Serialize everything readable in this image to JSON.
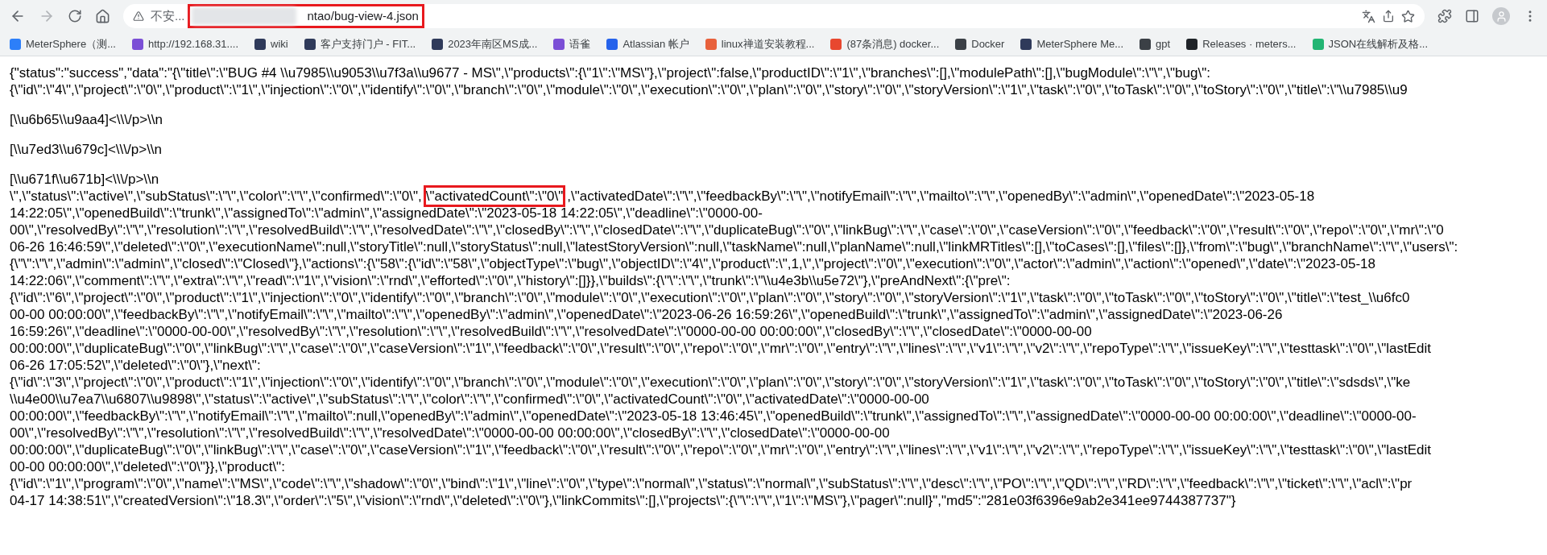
{
  "browser": {
    "address": {
      "security": "不安...",
      "url": "ntao/bug-view-4.json",
      "url_highlighted": true
    }
  },
  "bookmarks": [
    {
      "label": "MeterSphere（测...",
      "color": "#2d7ff9"
    },
    {
      "label": "http://192.168.31....",
      "color": "#7b4fd6"
    },
    {
      "label": "wiki",
      "color": "#2f3a5a"
    },
    {
      "label": "客户支持门户 - FIT...",
      "color": "#2f3a5a"
    },
    {
      "label": "2023年南区MS成...",
      "color": "#2f3a5a"
    },
    {
      "label": "语雀",
      "color": "#7b4fd6"
    },
    {
      "label": "Atlassian 帐户",
      "color": "#2663eb"
    },
    {
      "label": "linux禅道安装教程...",
      "color": "#e8613c"
    },
    {
      "label": "(87条消息) docker...",
      "color": "#e8472f"
    },
    {
      "label": "Docker",
      "color": "#3b4046"
    },
    {
      "label": "MeterSphere  Me...",
      "color": "#2f3a5a"
    },
    {
      "label": "gpt",
      "color": "#3b4046"
    },
    {
      "label": "Releases · meters...",
      "color": "#1f2328"
    },
    {
      "label": "JSON在线解析及格...",
      "color": "#22b573"
    }
  ],
  "paragraphs": [
    {
      "lines": [
        {
          "segments": [
            {
              "text": "{\"status\":\"success\",\"data\":\"{\\\"title\\\":\\\"BUG #4 \\\\u7985\\\\u9053\\\\u7f3a\\\\u9677 - MS\\\",\\\"products\\\":{\\\"1\\\":\\\"MS\\\"},\\\"project\\\":false,\\\"productID\\\":\\\"1\\\",\\\"branches\\\":[],\\\"modulePath\\\":[],\\\"bugModule\\\":\\\"\\\",\\\"bug\\\":",
              "highlighted": false
            }
          ]
        },
        {
          "segments": [
            {
              "text": "{\\\"id\\\":\\\"4\\\",\\\"project\\\":\\\"0\\\",\\\"product\\\":\\\"1\\\",\\\"injection\\\":\\\"0\\\",\\\"identify\\\":\\\"0\\\",\\\"branch\\\":\\\"0\\\",\\\"module\\\":\\\"0\\\",\\\"execution\\\":\\\"0\\\",\\\"plan\\\":\\\"0\\\",\\\"story\\\":\\\"0\\\",\\\"storyVersion\\\":\\\"1\\\",\\\"task\\\":\\\"0\\\",\\\"toTask\\\":\\\"0\\\",\\\"toStory\\\":\\\"0\\\",\\\"title\\\":\\\"\\\\u7985\\\\u9",
              "highlighted": false
            }
          ]
        }
      ]
    },
    {
      "lines": [
        {
          "segments": [
            {
              "text": "[\\\\u6b65\\\\u9aa4]<\\\\\\/p>\\\\n",
              "highlighted": false
            }
          ]
        }
      ]
    },
    {
      "lines": [
        {
          "segments": [
            {
              "text": "[\\\\u7ed3\\\\u679c]<\\\\\\/p>\\\\n",
              "highlighted": false
            }
          ]
        }
      ]
    },
    {
      "lines": [
        {
          "segments": [
            {
              "text": "[\\\\u671f\\\\u671b]<\\\\\\/p>\\\\n",
              "highlighted": false
            }
          ]
        },
        {
          "segments": [
            {
              "text": "\\\",\\\"status\\\":\\\"active\\\",\\\"subStatus\\\":\\\"\\\",\\\"color\\\":\\\"\\\",\\\"confirmed\\\":\\\"0\\\",",
              "highlighted": false
            },
            {
              "text": "\\\"activatedCount\\\":\\\"0\\\"",
              "highlighted": true
            },
            {
              "text": ",\\\"activatedDate\\\":\\\"\\\",\\\"feedbackBy\\\":\\\"\\\",\\\"notifyEmail\\\":\\\"\\\",\\\"mailto\\\":\\\"\\\",\\\"openedBy\\\":\\\"admin\\\",\\\"openedDate\\\":\\\"2023-05-18",
              "highlighted": false
            }
          ]
        },
        {
          "segments": [
            {
              "text": "14:22:05\\\",\\\"openedBuild\\\":\\\"trunk\\\",\\\"assignedTo\\\":\\\"admin\\\",\\\"assignedDate\\\":\\\"2023-05-18 14:22:05\\\",\\\"deadline\\\":\\\"0000-00-",
              "highlighted": false
            }
          ]
        },
        {
          "segments": [
            {
              "text": "00\\\",\\\"resolvedBy\\\":\\\"\\\",\\\"resolution\\\":\\\"\\\",\\\"resolvedBuild\\\":\\\"\\\",\\\"resolvedDate\\\":\\\"\\\",\\\"closedBy\\\":\\\"\\\",\\\"closedDate\\\":\\\"\\\",\\\"duplicateBug\\\":\\\"0\\\",\\\"linkBug\\\":\\\"\\\",\\\"case\\\":\\\"0\\\",\\\"caseVersion\\\":\\\"0\\\",\\\"feedback\\\":\\\"0\\\",\\\"result\\\":\\\"0\\\",\\\"repo\\\":\\\"0\\\",\\\"mr\\\":\\\"0",
              "highlighted": false
            }
          ]
        },
        {
          "segments": [
            {
              "text": "06-26 16:46:59\\\",\\\"deleted\\\":\\\"0\\\",\\\"executionName\\\":null,\\\"storyTitle\\\":null,\\\"storyStatus\\\":null,\\\"latestStoryVersion\\\":null,\\\"taskName\\\":null,\\\"planName\\\":null,\\\"linkMRTitles\\\":[],\\\"toCases\\\":[],\\\"files\\\":[]},\\\"from\\\":\\\"bug\\\",\\\"branchName\\\":\\\"\\\",\\\"users\\\":",
              "highlighted": false
            }
          ]
        },
        {
          "segments": [
            {
              "text": "{\\\"\\\":\\\"\\\",\\\"admin\\\":\\\"admin\\\",\\\"closed\\\":\\\"Closed\\\"},\\\"actions\\\":{\\\"58\\\":{\\\"id\\\":\\\"58\\\",\\\"objectType\\\":\\\"bug\\\",\\\"objectID\\\":\\\"4\\\",\\\"product\\\":\\\",1,\\\",\\\"project\\\":\\\"0\\\",\\\"execution\\\":\\\"0\\\",\\\"actor\\\":\\\"admin\\\",\\\"action\\\":\\\"opened\\\",\\\"date\\\":\\\"2023-05-18",
              "highlighted": false
            }
          ]
        },
        {
          "segments": [
            {
              "text": "14:22:06\\\",\\\"comment\\\":\\\"\\\",\\\"extra\\\":\\\"\\\",\\\"read\\\":\\\"1\\\",\\\"vision\\\":\\\"rnd\\\",\\\"efforted\\\":\\\"0\\\",\\\"history\\\":[]}},\\\"builds\\\":{\\\"\\\":\\\"\\\",\\\"trunk\\\":\\\"\\\\u4e3b\\\\u5e72\\\"},\\\"preAndNext\\\":{\\\"pre\\\":",
              "highlighted": false
            }
          ]
        },
        {
          "segments": [
            {
              "text": "{\\\"id\\\":\\\"6\\\",\\\"project\\\":\\\"0\\\",\\\"product\\\":\\\"1\\\",\\\"injection\\\":\\\"0\\\",\\\"identify\\\":\\\"0\\\",\\\"branch\\\":\\\"0\\\",\\\"module\\\":\\\"0\\\",\\\"execution\\\":\\\"0\\\",\\\"plan\\\":\\\"0\\\",\\\"story\\\":\\\"0\\\",\\\"storyVersion\\\":\\\"1\\\",\\\"task\\\":\\\"0\\\",\\\"toTask\\\":\\\"0\\\",\\\"toStory\\\":\\\"0\\\",\\\"title\\\":\\\"test_\\\\u6fc0",
              "highlighted": false
            }
          ]
        },
        {
          "segments": [
            {
              "text": "00-00 00:00:00\\\",\\\"feedbackBy\\\":\\\"\\\",\\\"notifyEmail\\\":\\\"\\\",\\\"mailto\\\":\\\"\\\",\\\"openedBy\\\":\\\"admin\\\",\\\"openedDate\\\":\\\"2023-06-26 16:59:26\\\",\\\"openedBuild\\\":\\\"trunk\\\",\\\"assignedTo\\\":\\\"admin\\\",\\\"assignedDate\\\":\\\"2023-06-26",
              "highlighted": false
            }
          ]
        },
        {
          "segments": [
            {
              "text": "16:59:26\\\",\\\"deadline\\\":\\\"0000-00-00\\\",\\\"resolvedBy\\\":\\\"\\\",\\\"resolution\\\":\\\"\\\",\\\"resolvedBuild\\\":\\\"\\\",\\\"resolvedDate\\\":\\\"0000-00-00 00:00:00\\\",\\\"closedBy\\\":\\\"\\\",\\\"closedDate\\\":\\\"0000-00-00",
              "highlighted": false
            }
          ]
        },
        {
          "segments": [
            {
              "text": "00:00:00\\\",\\\"duplicateBug\\\":\\\"0\\\",\\\"linkBug\\\":\\\"\\\",\\\"case\\\":\\\"0\\\",\\\"caseVersion\\\":\\\"1\\\",\\\"feedback\\\":\\\"0\\\",\\\"result\\\":\\\"0\\\",\\\"repo\\\":\\\"0\\\",\\\"mr\\\":\\\"0\\\",\\\"entry\\\":\\\"\\\",\\\"lines\\\":\\\"\\\",\\\"v1\\\":\\\"\\\",\\\"v2\\\":\\\"\\\",\\\"repoType\\\":\\\"\\\",\\\"issueKey\\\":\\\"\\\",\\\"testtask\\\":\\\"0\\\",\\\"lastEdit",
              "highlighted": false
            }
          ]
        },
        {
          "segments": [
            {
              "text": "06-26 17:05:52\\\",\\\"deleted\\\":\\\"0\\\"},\\\"next\\\":",
              "highlighted": false
            }
          ]
        },
        {
          "segments": [
            {
              "text": "{\\\"id\\\":\\\"3\\\",\\\"project\\\":\\\"0\\\",\\\"product\\\":\\\"1\\\",\\\"injection\\\":\\\"0\\\",\\\"identify\\\":\\\"0\\\",\\\"branch\\\":\\\"0\\\",\\\"module\\\":\\\"0\\\",\\\"execution\\\":\\\"0\\\",\\\"plan\\\":\\\"0\\\",\\\"story\\\":\\\"0\\\",\\\"storyVersion\\\":\\\"1\\\",\\\"task\\\":\\\"0\\\",\\\"toTask\\\":\\\"0\\\",\\\"toStory\\\":\\\"0\\\",\\\"title\\\":\\\"sdsds\\\",\\\"ke",
              "highlighted": false
            }
          ]
        },
        {
          "segments": [
            {
              "text": "\\\\u4e00\\\\u7ea7\\\\u6807\\\\u9898\\\",\\\"status\\\":\\\"active\\\",\\\"subStatus\\\":\\\"\\\",\\\"color\\\":\\\"\\\",\\\"confirmed\\\":\\\"0\\\",\\\"activatedCount\\\":\\\"0\\\",\\\"activatedDate\\\":\\\"0000-00-00",
              "highlighted": false
            }
          ]
        },
        {
          "segments": [
            {
              "text": "00:00:00\\\",\\\"feedbackBy\\\":\\\"\\\",\\\"notifyEmail\\\":\\\"\\\",\\\"mailto\\\":null,\\\"openedBy\\\":\\\"admin\\\",\\\"openedDate\\\":\\\"2023-05-18 13:46:45\\\",\\\"openedBuild\\\":\\\"trunk\\\",\\\"assignedTo\\\":\\\"\\\",\\\"assignedDate\\\":\\\"0000-00-00 00:00:00\\\",\\\"deadline\\\":\\\"0000-00-",
              "highlighted": false
            }
          ]
        },
        {
          "segments": [
            {
              "text": "00\\\",\\\"resolvedBy\\\":\\\"\\\",\\\"resolution\\\":\\\"\\\",\\\"resolvedBuild\\\":\\\"\\\",\\\"resolvedDate\\\":\\\"0000-00-00 00:00:00\\\",\\\"closedBy\\\":\\\"\\\",\\\"closedDate\\\":\\\"0000-00-00",
              "highlighted": false
            }
          ]
        },
        {
          "segments": [
            {
              "text": "00:00:00\\\",\\\"duplicateBug\\\":\\\"0\\\",\\\"linkBug\\\":\\\"\\\",\\\"case\\\":\\\"0\\\",\\\"caseVersion\\\":\\\"1\\\",\\\"feedback\\\":\\\"0\\\",\\\"result\\\":\\\"0\\\",\\\"repo\\\":\\\"0\\\",\\\"mr\\\":\\\"0\\\",\\\"entry\\\":\\\"\\\",\\\"lines\\\":\\\"\\\",\\\"v1\\\":\\\"\\\",\\\"v2\\\":\\\"\\\",\\\"repoType\\\":\\\"\\\",\\\"issueKey\\\":\\\"\\\",\\\"testtask\\\":\\\"0\\\",\\\"lastEdit",
              "highlighted": false
            }
          ]
        },
        {
          "segments": [
            {
              "text": "00-00 00:00:00\\\",\\\"deleted\\\":\\\"0\\\"}},\\\"product\\\":",
              "highlighted": false
            }
          ]
        },
        {
          "segments": [
            {
              "text": "{\\\"id\\\":\\\"1\\\",\\\"program\\\":\\\"0\\\",\\\"name\\\":\\\"MS\\\",\\\"code\\\":\\\"\\\",\\\"shadow\\\":\\\"0\\\",\\\"bind\\\":\\\"1\\\",\\\"line\\\":\\\"0\\\",\\\"type\\\":\\\"normal\\\",\\\"status\\\":\\\"normal\\\",\\\"subStatus\\\":\\\"\\\",\\\"desc\\\":\\\"\\\",\\\"PO\\\":\\\"\\\",\\\"QD\\\":\\\"\\\",\\\"RD\\\":\\\"\\\",\\\"feedback\\\":\\\"\\\",\\\"ticket\\\":\\\"\\\",\\\"acl\\\":\\\"pr",
              "highlighted": false
            }
          ]
        },
        {
          "segments": [
            {
              "text": "04-17 14:38:51\\\",\\\"createdVersion\\\":\\\"18.3\\\",\\\"order\\\":\\\"5\\\",\\\"vision\\\":\\\"rnd\\\",\\\"deleted\\\":\\\"0\\\"},\\\"linkCommits\\\":[],\\\"projects\\\":{\\\"\\\":\\\"\\\",\\\"1\\\":\\\"MS\\\"},\\\"pager\\\":null}\",\"md5\":\"281e03f6396e9ab2e341ee9744387737\"}",
              "highlighted": false
            }
          ]
        }
      ]
    }
  ]
}
